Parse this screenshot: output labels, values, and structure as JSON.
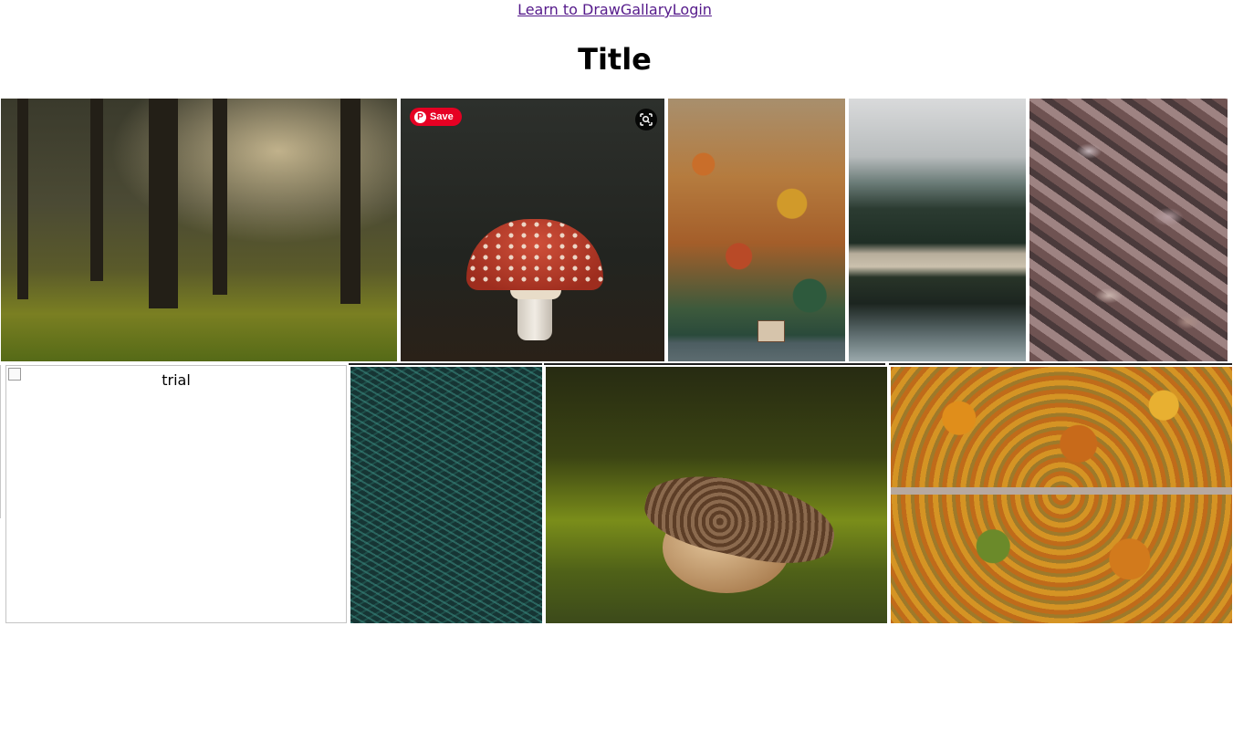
{
  "nav": {
    "link_learn": "Learn to Draw",
    "link_gallery": "Gallary",
    "link_login": "Login"
  },
  "page": {
    "title": "Title"
  },
  "pin_overlay": {
    "save_label": "Save",
    "color": "#e60023"
  },
  "gallery": {
    "row1": [
      {
        "name": "sunlit-forest-image",
        "kind": "photo"
      },
      {
        "name": "red-mushroom-image",
        "kind": "photo"
      },
      {
        "name": "autumn-hillside-image",
        "kind": "photo"
      },
      {
        "name": "misty-lake-image",
        "kind": "photo"
      },
      {
        "name": "oak-leaves-image",
        "kind": "photo"
      }
    ],
    "row2": [
      {
        "name": "broken-image",
        "kind": "missing",
        "alt": "trial"
      },
      {
        "name": "pine-branches-image",
        "kind": "photo"
      },
      {
        "name": "acorn-image",
        "kind": "photo"
      },
      {
        "name": "aerial-autumn-forest-image",
        "kind": "photo"
      }
    ]
  },
  "icons": {
    "pinterest": "pinterest-icon",
    "visual_search": "visual-search-icon",
    "broken_image": "broken-image-icon"
  },
  "colors": {
    "link": "#551a8b",
    "title": "#000000",
    "background": "#ffffff"
  }
}
